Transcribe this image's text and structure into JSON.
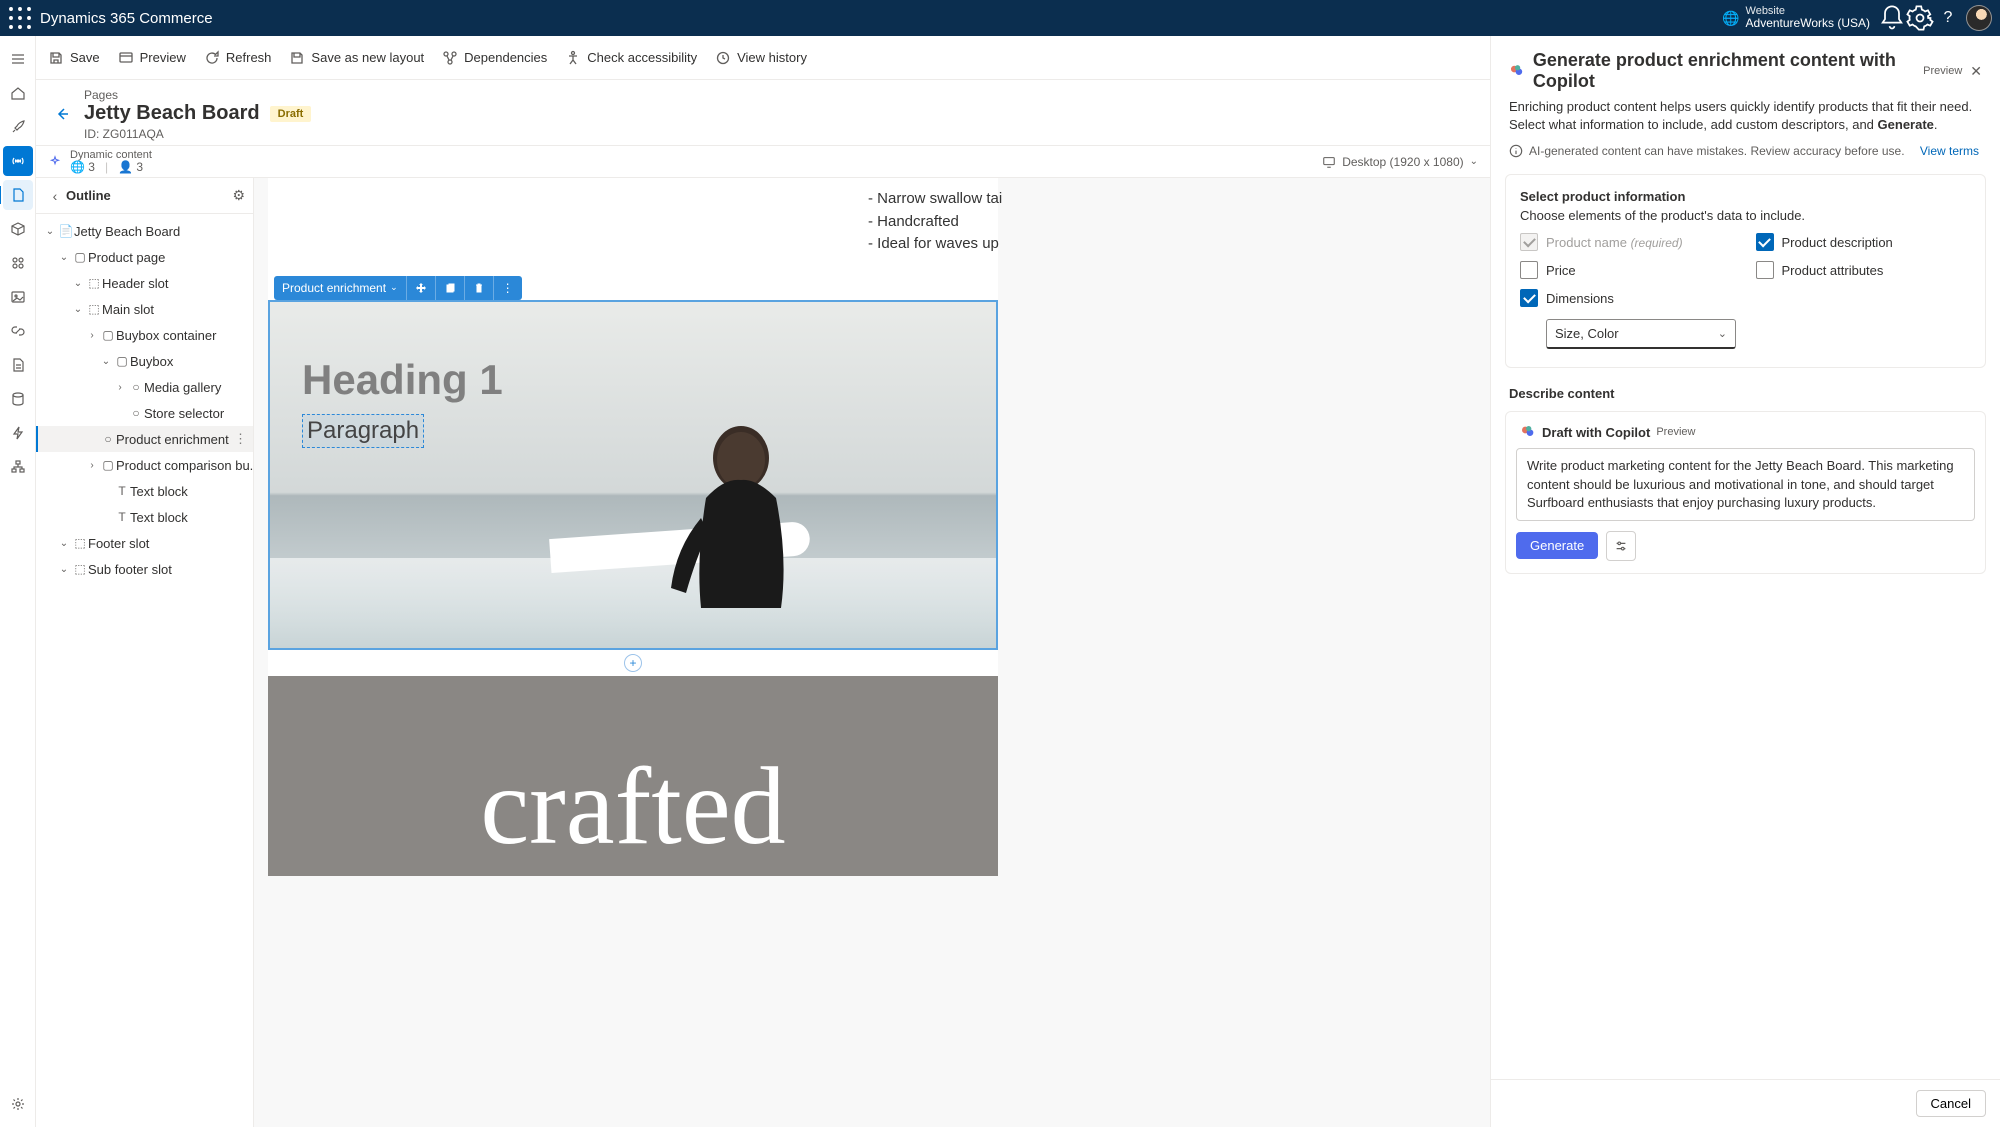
{
  "app_title": "Dynamics 365 Commerce",
  "website_label": "Website",
  "website_name": "AdventureWorks (USA)",
  "toolbar": {
    "save": "Save",
    "preview": "Preview",
    "refresh": "Refresh",
    "save_as_layout": "Save as new layout",
    "dependencies": "Dependencies",
    "accessibility": "Check accessibility",
    "history": "View history"
  },
  "breadcrumb": "Pages",
  "page_title": "Jetty Beach Board",
  "status_badge": "Draft",
  "page_id": "ID: ZG011AQA",
  "dynamic": {
    "label": "Dynamic content",
    "globe_count": "3",
    "user_count": "3"
  },
  "viewport": "Desktop (1920 x 1080)",
  "outline": {
    "title": "Outline",
    "nodes": {
      "root": "Jetty Beach Board",
      "product_page": "Product page",
      "header_slot": "Header slot",
      "main_slot": "Main slot",
      "buybox_container": "Buybox container",
      "buybox": "Buybox",
      "media_gallery": "Media gallery",
      "store_selector": "Store selector",
      "product_enrichment": "Product enrichment",
      "product_comparison": "Product comparison bu...",
      "text_block1": "Text block",
      "text_block2": "Text block",
      "footer_slot": "Footer slot",
      "sub_footer_slot": "Sub footer slot"
    }
  },
  "canvas": {
    "features": [
      "- Narrow swallow tai",
      "- Handcrafted",
      "- Ideal for waves up"
    ],
    "module_label": "Product enrichment",
    "heading": "Heading 1",
    "paragraph": "Paragraph",
    "crafted": "crafted"
  },
  "panel": {
    "title": "Generate product enrichment content with Copilot",
    "preview_tag": "Preview",
    "intro_a": "Enriching product content helps users quickly identify products that fit their need. Select what information to include, add custom descriptors, and ",
    "intro_b": "Generate",
    "disclaimer": "AI-generated content can have mistakes. Review accuracy before use.",
    "view_terms": "View terms",
    "section_title": "Select product information",
    "section_sub": "Choose elements of the product's data to include.",
    "opt_name": "Product name",
    "opt_name_req": "(required)",
    "opt_desc": "Product description",
    "opt_price": "Price",
    "opt_attrs": "Product attributes",
    "opt_dims": "Dimensions",
    "dim_value": "Size, Color",
    "describe_label": "Describe content",
    "draft_title": "Draft with Copilot",
    "draft_preview": "Preview",
    "prompt": "Write product marketing content for the Jetty Beach Board. This marketing content should be luxurious and motivational in tone, and should target Surfboard enthusiasts that enjoy purchasing luxury products.",
    "generate": "Generate",
    "cancel": "Cancel"
  }
}
